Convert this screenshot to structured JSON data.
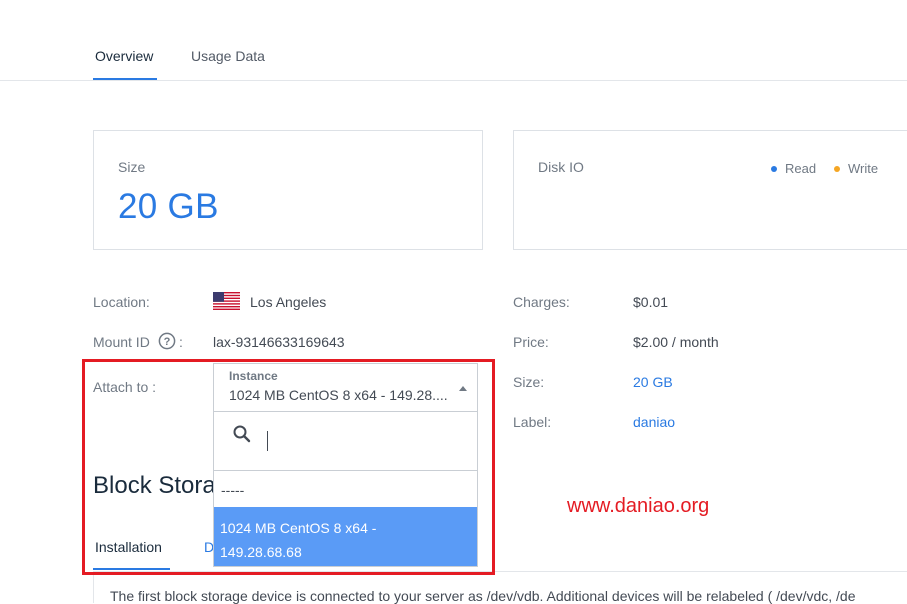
{
  "tabs": [
    {
      "label": "Overview",
      "active": true
    },
    {
      "label": "Usage Data",
      "active": false
    }
  ],
  "size_card": {
    "label": "Size",
    "value": "20 GB"
  },
  "disk_io_card": {
    "label": "Disk IO",
    "legend": [
      {
        "label": "Read",
        "color": "#2a7ae2"
      },
      {
        "label": "Write",
        "color": "#f5a623"
      }
    ]
  },
  "details_left": {
    "location_label": "Location:",
    "location_value": "Los Angeles",
    "location_flag": "us-flag-icon",
    "mount_label": "Mount ID",
    "mount_colon": ":",
    "mount_value": "lax-93146633169643",
    "attach_label": "Attach to :"
  },
  "details_right": {
    "charges_label": "Charges:",
    "charges_value": "$0.01",
    "price_label": "Price:",
    "price_value": "$2.00 / month",
    "size_label": "Size:",
    "size_value": "20 GB",
    "label_label": "Label:",
    "label_value": "daniao"
  },
  "instance_select": {
    "caption": "Instance",
    "selected": "1024 MB CentOS 8 x64 - 149.28....",
    "search_placeholder": "",
    "options": [
      {
        "label": "-----",
        "highlighted": false
      },
      {
        "label": "1024 MB CentOS 8 x64 - 149.28.68.68",
        "highlighted": true
      }
    ]
  },
  "block_storage": {
    "title": "Block Stora",
    "tab_installation": "Installation",
    "tab_second_partial": "D",
    "body_text": "The first block storage device is connected to your server as /dev/vdb. Additional devices will be relabeled ( /dev/vdc, /de"
  },
  "watermark": "www.daniao.org",
  "colors": {
    "accent": "#2a7ae2",
    "highlight": "#e41b23",
    "option_selected": "#5a9bf6"
  }
}
